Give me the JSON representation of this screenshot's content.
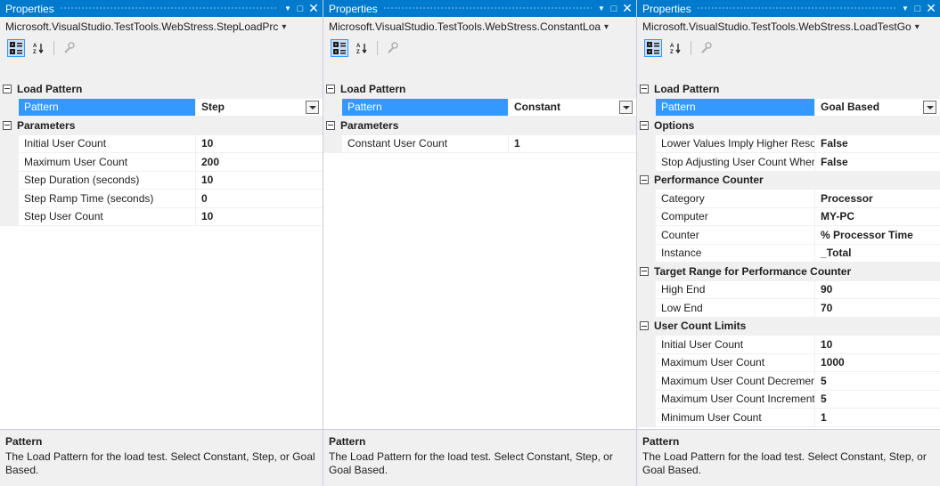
{
  "panels": [
    {
      "title": "Properties",
      "object": "Microsoft.VisualStudio.TestTools.WebStress.StepLoadPrc",
      "categories": [
        {
          "label": "Load Pattern",
          "rows": [
            {
              "name": "Pattern",
              "value": "Step",
              "selected": true
            }
          ]
        },
        {
          "label": "Parameters",
          "rows": [
            {
              "name": "Initial User Count",
              "value": "10"
            },
            {
              "name": "Maximum User Count",
              "value": "200"
            },
            {
              "name": "Step Duration (seconds)",
              "value": "10"
            },
            {
              "name": "Step Ramp Time (seconds)",
              "value": "0"
            },
            {
              "name": "Step User Count",
              "value": "10"
            }
          ]
        }
      ],
      "desc_title": "Pattern",
      "desc_text": "The Load Pattern for the load test. Select Constant, Step, or Goal  Based."
    },
    {
      "title": "Properties",
      "object": "Microsoft.VisualStudio.TestTools.WebStress.ConstantLoa",
      "categories": [
        {
          "label": "Load Pattern",
          "rows": [
            {
              "name": "Pattern",
              "value": "Constant",
              "selected": true
            }
          ]
        },
        {
          "label": "Parameters",
          "rows": [
            {
              "name": "Constant User Count",
              "value": "1"
            }
          ]
        }
      ],
      "desc_title": "Pattern",
      "desc_text": "The Load Pattern for the load test. Select Constant, Step, or Goal  Based."
    },
    {
      "title": "Properties",
      "object": "Microsoft.VisualStudio.TestTools.WebStress.LoadTestGo",
      "categories": [
        {
          "label": "Load Pattern",
          "rows": [
            {
              "name": "Pattern",
              "value": "Goal Based",
              "selected": true
            }
          ]
        },
        {
          "label": "Options",
          "rows": [
            {
              "name": "Lower Values Imply Higher Resour",
              "value": "False"
            },
            {
              "name": "Stop Adjusting User Count When (",
              "value": "False"
            }
          ]
        },
        {
          "label": "Performance Counter",
          "rows": [
            {
              "name": "Category",
              "value": "Processor"
            },
            {
              "name": "Computer",
              "value": "MY-PC"
            },
            {
              "name": "Counter",
              "value": "% Processor Time"
            },
            {
              "name": "Instance",
              "value": "_Total"
            }
          ]
        },
        {
          "label": "Target Range for Performance Counter",
          "rows": [
            {
              "name": "High End",
              "value": "90"
            },
            {
              "name": "Low End",
              "value": "70"
            }
          ]
        },
        {
          "label": "User Count Limits",
          "rows": [
            {
              "name": "Initial User Count",
              "value": "10"
            },
            {
              "name": "Maximum User Count",
              "value": "1000"
            },
            {
              "name": "Maximum User Count Decrement",
              "value": "5"
            },
            {
              "name": "Maximum User Count Increment",
              "value": "5"
            },
            {
              "name": "Minimum User Count",
              "value": "1"
            }
          ]
        }
      ],
      "desc_title": "Pattern",
      "desc_text": "The Load Pattern for the load test. Select Constant, Step, or Goal  Based."
    }
  ],
  "icons": {
    "window_position": "dropdown-arrow-icon",
    "maximize": "maximize-icon",
    "close": "close-icon",
    "categorized": "categorized-icon",
    "alphabetical": "alphabetical-sort-icon",
    "property_pages": "property-pages-icon"
  },
  "colors": {
    "title_bar": "#007acc",
    "selection": "#3399ff",
    "panel_bg": "#f0f0f0"
  }
}
